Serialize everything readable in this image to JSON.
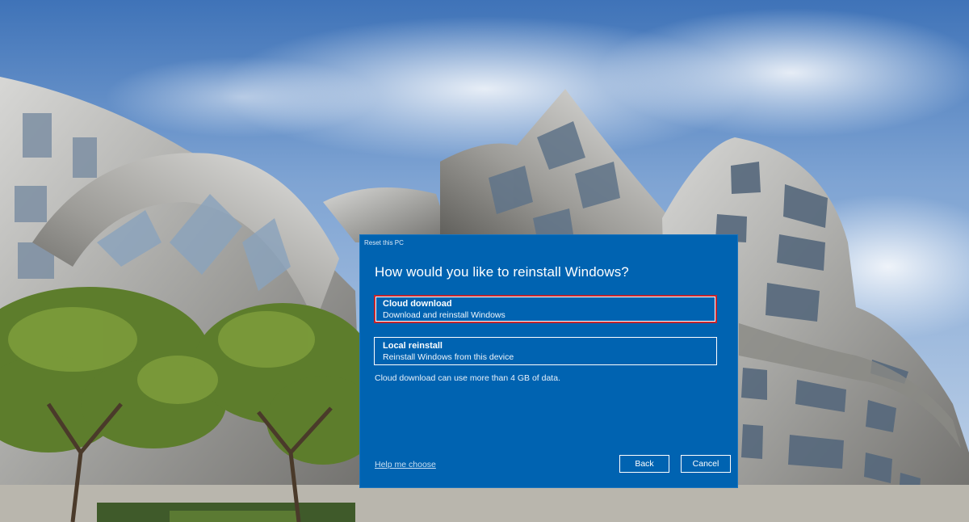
{
  "dialog": {
    "caption": "Reset this PC",
    "heading": "How would you like to reinstall Windows?",
    "options": [
      {
        "title": "Cloud download",
        "description": "Download and reinstall Windows",
        "selected": true
      },
      {
        "title": "Local reinstall",
        "description": "Reinstall Windows from this device",
        "selected": false
      }
    ],
    "note": "Cloud download can use more than 4 GB of data.",
    "help_link": "Help me choose",
    "back_label": "Back",
    "cancel_label": "Cancel"
  },
  "colors": {
    "dialog_bg": "#0063b1",
    "selection_border": "#c4262e",
    "sky": "#5a86c0"
  }
}
